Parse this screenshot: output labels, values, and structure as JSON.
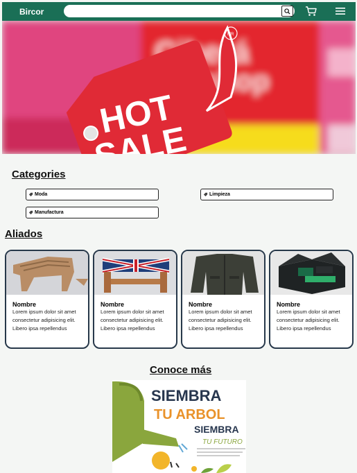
{
  "header": {
    "brand": "Bircor",
    "search_placeholder": "",
    "icons": [
      "search-icon",
      "cart-icon",
      "menu-icon"
    ]
  },
  "banner": {
    "tag_text_line1": "HOT",
    "tag_text_line2": "SALE",
    "badge": "MR",
    "background_words": [
      "Ciberá",
      "shop"
    ]
  },
  "categories": {
    "title": "Categories",
    "items": [
      "Moda",
      "Limpieza",
      "Manufactura"
    ]
  },
  "aliados": {
    "title": "Aliados",
    "cards": [
      {
        "name": "Nombre",
        "description": "Lorem ipsum dolor sit amet consectetur adipisicing elit. Libero ipsa repellendus"
      },
      {
        "name": "Nombre",
        "description": "Lorem ipsum dolor sit amet consectetur adipisicing elit. Libero ipsa repellendus"
      },
      {
        "name": "Nombre",
        "description": "Lorem ipsum dolor sit amet consectetur adipisicing elit. Libero ipsa repellendus"
      },
      {
        "name": "Nombre",
        "description": "Lorem ipsum dolor sit amet consectetur adipisicing elit. Libero ipsa repellendus"
      }
    ]
  },
  "conoce": {
    "title": "Conoce más",
    "poster_line1": "SIEMBRA",
    "poster_line2": "TU ARBOL",
    "poster_line3": "SIEMBRA",
    "poster_line4": "TU FUTURO"
  },
  "colors": {
    "header": "#1a6f56",
    "card_border": "#27384a",
    "sale_red": "#e02a36"
  }
}
